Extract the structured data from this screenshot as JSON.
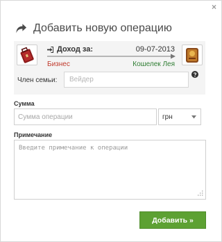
{
  "dialog": {
    "close_label": "×",
    "title": "Добавить новую операцию"
  },
  "flow": {
    "type_label": "Доход за:",
    "date": "09-07-2013",
    "from": "Бизнес",
    "to": "Кошелек Лея",
    "from_color": "#c0392b",
    "to_color": "#2e7d32"
  },
  "member": {
    "label": "Член семьи:",
    "placeholder": "Вейдер"
  },
  "amount": {
    "label": "Сумма",
    "placeholder": "Сумма операции",
    "currency": "грн"
  },
  "note": {
    "label": "Примечание",
    "placeholder": "Введите примечание к операции"
  },
  "submit": {
    "label": "Добавить »",
    "color": "#5da133"
  },
  "icons": {
    "title": "share-arrow-icon",
    "source": "briefcase-icon",
    "target": "wallet-icon",
    "help": "question-circle-icon",
    "flow_type": "sign-in-icon",
    "dropdown": "caret-down-icon"
  }
}
